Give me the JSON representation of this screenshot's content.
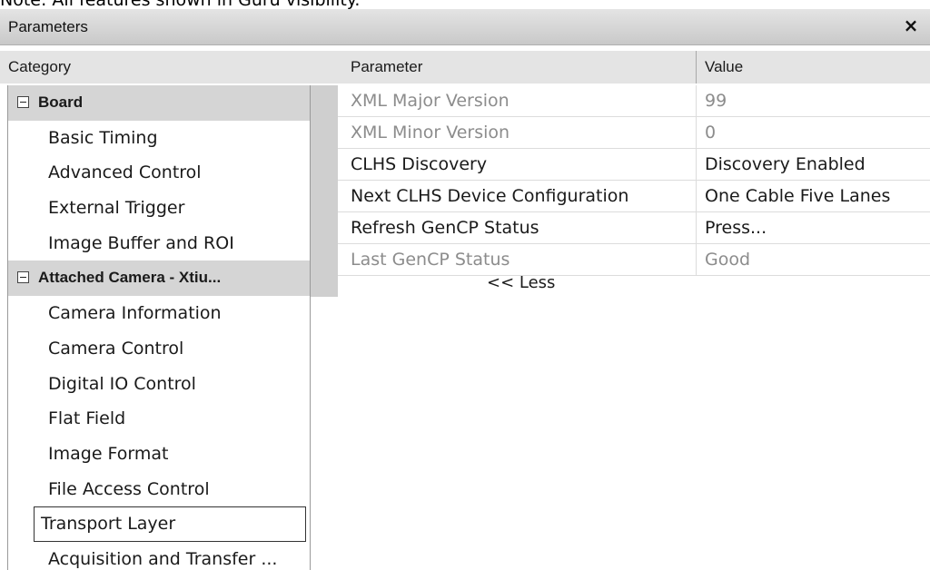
{
  "note": "Note: All features shown in Guru visibility.",
  "window": {
    "title": "Parameters",
    "close_glyph": "×"
  },
  "columns": {
    "category": "Category",
    "parameter": "Parameter",
    "value": "Value"
  },
  "categories": [
    {
      "label": "Board",
      "type": "group",
      "expanded": true
    },
    {
      "label": "Basic Timing",
      "type": "item"
    },
    {
      "label": "Advanced Control",
      "type": "item"
    },
    {
      "label": "External Trigger",
      "type": "item"
    },
    {
      "label": "Image Buffer and ROI",
      "type": "item"
    },
    {
      "label": "Attached Camera - Xtiu...",
      "type": "group",
      "expanded": true
    },
    {
      "label": "Camera Information",
      "type": "item"
    },
    {
      "label": "Camera Control",
      "type": "item"
    },
    {
      "label": "Digital IO Control",
      "type": "item"
    },
    {
      "label": "Flat Field",
      "type": "item"
    },
    {
      "label": "Image Format",
      "type": "item"
    },
    {
      "label": "File Access Control",
      "type": "item"
    },
    {
      "label": "Transport Layer",
      "type": "item",
      "selected": true
    },
    {
      "label": "Acquisition and Transfer ...",
      "type": "item"
    }
  ],
  "parameters": [
    {
      "name": "XML Major Version",
      "value": "99",
      "enabled": false
    },
    {
      "name": "XML Minor Version",
      "value": "0",
      "enabled": false
    },
    {
      "name": "CLHS Discovery",
      "value": "Discovery Enabled",
      "enabled": true
    },
    {
      "name": "Next CLHS Device Configuration",
      "value": "One Cable Five Lanes",
      "enabled": true
    },
    {
      "name": "Refresh GenCP Status",
      "value": "Press...",
      "enabled": true
    },
    {
      "name": "Last GenCP Status",
      "value": "Good",
      "enabled": false
    }
  ],
  "less_label": "<< Less"
}
